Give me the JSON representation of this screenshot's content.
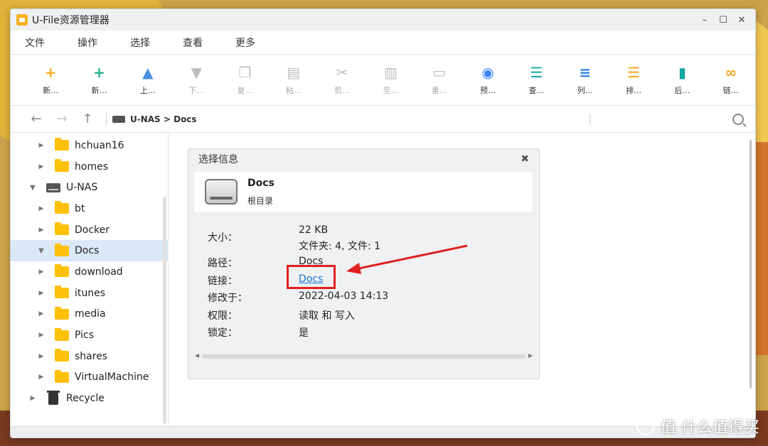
{
  "window": {
    "title": "U-File资源管理器",
    "min": "–",
    "max": "☐",
    "close": "✕"
  },
  "menu": [
    "文件",
    "操作",
    "选择",
    "查看",
    "更多"
  ],
  "toolbar": [
    {
      "label": "新…",
      "icon": "new-folder-icon",
      "disabled": false
    },
    {
      "label": "新…",
      "icon": "new-file-icon",
      "disabled": false
    },
    {
      "label": "上…",
      "icon": "upload-icon",
      "disabled": false
    },
    {
      "label": "下…",
      "icon": "download-icon",
      "disabled": true
    },
    {
      "label": "复…",
      "icon": "copy-icon",
      "disabled": true
    },
    {
      "label": "粘…",
      "icon": "paste-icon",
      "disabled": true
    },
    {
      "label": "剪…",
      "icon": "cut-icon",
      "disabled": true
    },
    {
      "label": "至…",
      "icon": "trash-icon",
      "disabled": true
    },
    {
      "label": "重…",
      "icon": "rename-icon",
      "disabled": true
    },
    {
      "label": "预…",
      "icon": "preview-icon",
      "disabled": false
    },
    {
      "label": "查…",
      "icon": "view-icon",
      "disabled": false
    },
    {
      "label": "列…",
      "icon": "list-icon",
      "disabled": false
    },
    {
      "label": "排…",
      "icon": "sort-icon",
      "disabled": false
    },
    {
      "label": "后…",
      "icon": "panel-icon",
      "disabled": false
    },
    {
      "label": "链…",
      "icon": "link-icon",
      "disabled": false
    }
  ],
  "address": {
    "path": "U-NAS > Docs"
  },
  "tree": [
    {
      "label": "hchuan16",
      "type": "folder",
      "level": 1
    },
    {
      "label": "homes",
      "type": "folder",
      "level": 1
    },
    {
      "label": "U-NAS",
      "type": "nas",
      "level": 0,
      "expanded": true
    },
    {
      "label": "bt",
      "type": "folder",
      "level": 1
    },
    {
      "label": "Docker",
      "type": "folder",
      "level": 1
    },
    {
      "label": "Docs",
      "type": "folder",
      "level": 1,
      "expanded": true,
      "selected": true
    },
    {
      "label": "download",
      "type": "folder",
      "level": 1
    },
    {
      "label": "itunes",
      "type": "folder",
      "level": 1
    },
    {
      "label": "media",
      "type": "folder",
      "level": 1
    },
    {
      "label": "Pics",
      "type": "folder",
      "level": 1
    },
    {
      "label": "shares",
      "type": "folder",
      "level": 1
    },
    {
      "label": "VirtualMachine",
      "type": "folder",
      "level": 1
    },
    {
      "label": "Recycle",
      "type": "recycle",
      "level": 0
    }
  ],
  "dialog": {
    "title": "选择信息",
    "close": "✖",
    "name": "Docs",
    "subtitle": "根目录",
    "size_label": "大小：",
    "size_value": "22 KB",
    "count_value": "文件夹: 4, 文件: 1",
    "path_label": "路径：",
    "path_value": "Docs",
    "link_label": "链接：",
    "link_value": "Docs",
    "modified_label": "修改于：",
    "modified_value": "2022-04-03 14:13",
    "perm_label": "权限：",
    "perm_value": "读取 和 写入",
    "lock_label": "锁定：",
    "lock_value": "是"
  },
  "colors": {
    "accent": "#1976d2",
    "highlight": "#e02020",
    "folder": "#ffc107"
  },
  "watermark": "值 什么值得买"
}
